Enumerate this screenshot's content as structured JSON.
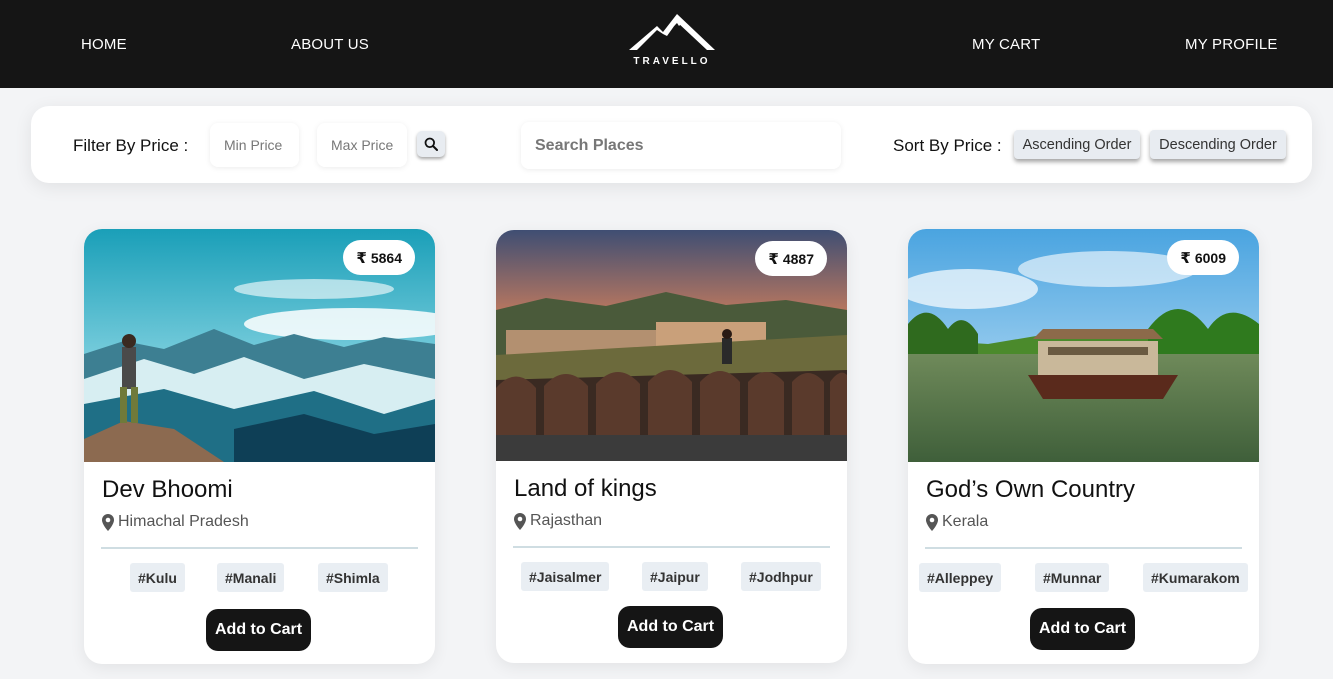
{
  "nav": {
    "home": "HOME",
    "about": "ABOUT US",
    "logo_text": "TRAVELLO",
    "cart": "MY CART",
    "profile": "MY PROFILE"
  },
  "filter": {
    "filter_label": "Filter By Price :",
    "min_placeholder": "Min Price",
    "max_placeholder": "Max Price",
    "search_placeholder": "Search Places",
    "sort_label": "Sort By Price :",
    "ascending": "Ascending Order",
    "descending": "Descending Order"
  },
  "cards": [
    {
      "price": "5864",
      "title": "Dev Bhoomi",
      "location": "Himachal Pradesh",
      "tags": [
        "#Kulu",
        "#Manali",
        "#Shimla"
      ],
      "button": "Add to Cart"
    },
    {
      "price": "4887",
      "title": "Land of kings",
      "location": "Rajasthan",
      "tags": [
        "#Jaisalmer",
        "#Jaipur",
        "#Jodhpur"
      ],
      "button": "Add to Cart"
    },
    {
      "price": "6009",
      "title": "God’s Own Country",
      "location": "Kerala",
      "tags": [
        "#Alleppey",
        "#Munnar",
        "#Kumarakom"
      ],
      "button": "Add to Cart"
    }
  ],
  "currency_symbol": "₹"
}
